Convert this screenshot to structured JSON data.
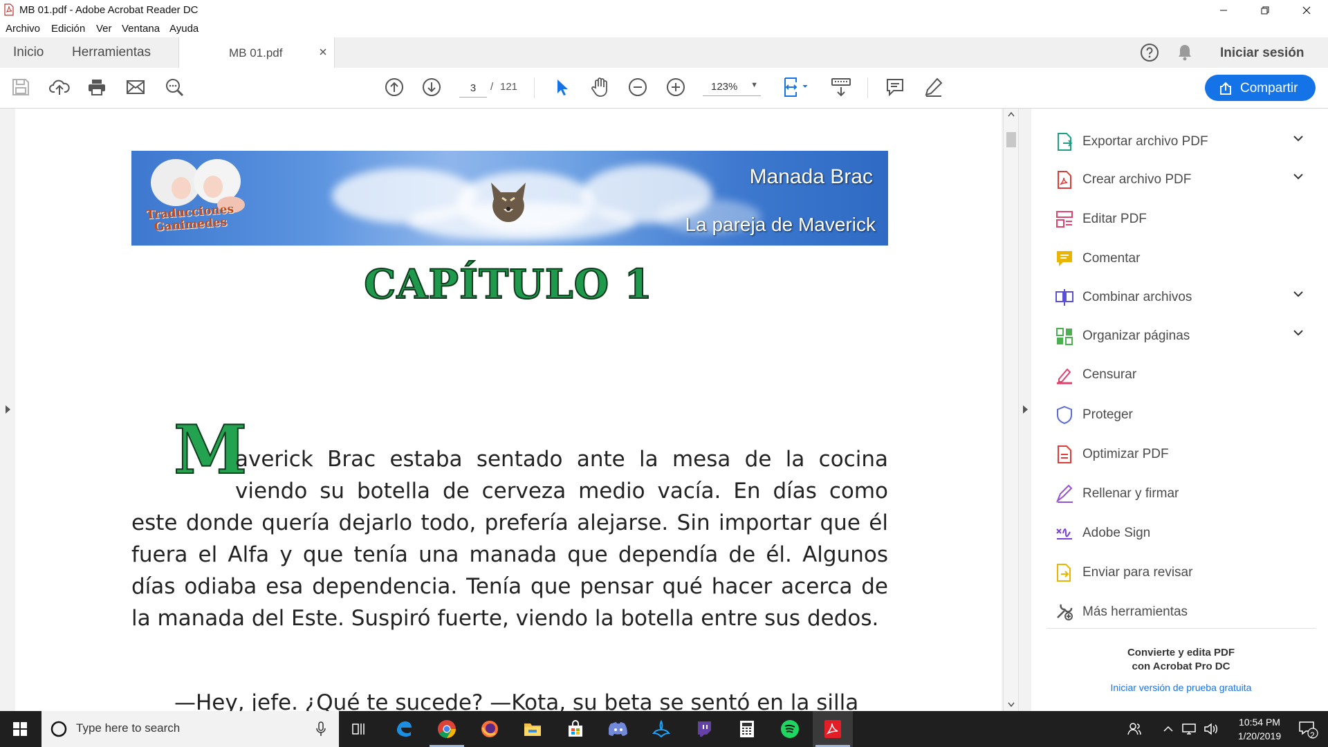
{
  "window": {
    "title": "MB 01.pdf - Adobe Acrobat Reader DC"
  },
  "menu": [
    "Archivo",
    "Edición",
    "Ver",
    "Ventana",
    "Ayuda"
  ],
  "tabs": {
    "home": "Inicio",
    "tools": "Herramientas",
    "document": "MB 01.pdf",
    "signin": "Iniciar sesión"
  },
  "toolbar": {
    "page_current": "3",
    "page_separator": "/",
    "page_total": "121",
    "zoom": "123%",
    "share_label": "Compartir"
  },
  "document": {
    "banner_title": "Manada Brac",
    "banner_subtitle": "La pareja de Maverick",
    "banner_logo": "Traducciones Ganimedes",
    "chapter": "CAPÍTULO 1",
    "dropcap": "M",
    "p1_line1": "averick Brac estaba sentado ante la mesa de la cocina viendo su botella de cerveza medio vacía. En días como",
    "p1_rest": "este donde quería dejarlo todo, prefería alejarse. Sin importar que él fuera el Alfa y que tenía una manada que dependía de él. Algunos días odiaba esa dependencia. Tenía que pensar qué hacer acerca de la manada del Este. Suspiró fuerte, viendo la botella entre sus dedos.",
    "p2_start": "—Hey, jefe. ¿Qué te sucede? —Kota, su beta se sentó en la silla"
  },
  "tools_panel": {
    "items": [
      {
        "label": "Exportar archivo PDF",
        "icon": "export-pdf-icon",
        "expandable": true,
        "color": "#1e9e86"
      },
      {
        "label": "Crear archivo PDF",
        "icon": "create-pdf-icon",
        "expandable": true,
        "color": "#e03b3b"
      },
      {
        "label": "Editar PDF",
        "icon": "edit-pdf-icon",
        "expandable": false,
        "color": "#e0426e"
      },
      {
        "label": "Comentar",
        "icon": "comment-icon",
        "expandable": false,
        "color": "#e9b500"
      },
      {
        "label": "Combinar archivos",
        "icon": "combine-files-icon",
        "expandable": true,
        "color": "#5b4fd6"
      },
      {
        "label": "Organizar páginas",
        "icon": "organize-pages-icon",
        "expandable": true,
        "color": "#4caf50"
      },
      {
        "label": "Censurar",
        "icon": "redact-icon",
        "expandable": false,
        "color": "#e0426e"
      },
      {
        "label": "Proteger",
        "icon": "protect-icon",
        "expandable": false,
        "color": "#5b6ad6"
      },
      {
        "label": "Optimizar PDF",
        "icon": "optimize-pdf-icon",
        "expandable": false,
        "color": "#e03b3b"
      },
      {
        "label": "Rellenar y firmar",
        "icon": "fill-sign-icon",
        "expandable": false,
        "color": "#9a4fd6"
      },
      {
        "label": "Adobe Sign",
        "icon": "adobe-sign-icon",
        "expandable": false,
        "color": "#7a3fd6"
      },
      {
        "label": "Enviar para revisar",
        "icon": "send-review-icon",
        "expandable": false,
        "color": "#e9b500"
      },
      {
        "label": "Más herramientas",
        "icon": "more-tools-icon",
        "expandable": false,
        "color": "#555555"
      }
    ],
    "promo_line1": "Convierte y edita PDF",
    "promo_line2": "con Acrobat Pro DC",
    "promo_link": "Iniciar versión de prueba gratuita"
  },
  "taskbar": {
    "search_placeholder": "Type here to search",
    "time": "10:54 PM",
    "date": "1/20/2019",
    "notification_count": "2"
  },
  "colors": {
    "accent": "#1473e6",
    "chapter_green": "#1f9a4c",
    "taskbar": "#1f1f1f"
  }
}
